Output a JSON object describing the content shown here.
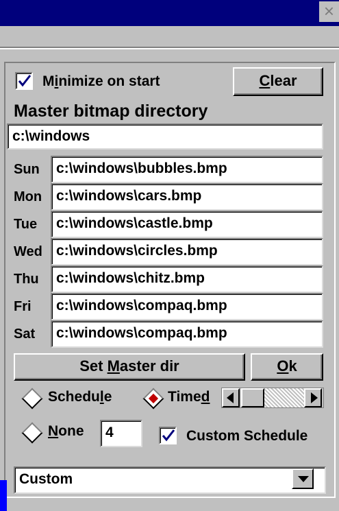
{
  "window": {
    "close_glyph": "×"
  },
  "minimize": {
    "label_pre": "M",
    "label_mnemonic": "i",
    "label_post": "nimize on start",
    "checked": true
  },
  "clear_button": {
    "mnemonic": "C",
    "rest": "lear"
  },
  "master": {
    "heading": "Master bitmap directory",
    "value": "c:\\windows"
  },
  "days": [
    {
      "label": "Sun",
      "path": "c:\\windows\\bubbles.bmp"
    },
    {
      "label": "Mon",
      "path": "c:\\windows\\cars.bmp"
    },
    {
      "label": "Tue",
      "path": "c:\\windows\\castle.bmp"
    },
    {
      "label": "Wed",
      "path": "c:\\windows\\circles.bmp"
    },
    {
      "label": "Thu",
      "path": "c:\\windows\\chitz.bmp"
    },
    {
      "label": "Fri",
      "path": "c:\\windows\\compaq.bmp"
    },
    {
      "label": "Sat",
      "path": "c:\\windows\\compaq.bmp"
    }
  ],
  "set_master_button": {
    "pre": "Set ",
    "mnemonic": "M",
    "post": "aster dir"
  },
  "ok_button": {
    "mnemonic": "O",
    "rest": "k"
  },
  "radios": {
    "schedule": {
      "pre": "Schedu",
      "mnemonic": "l",
      "post": "e",
      "selected": false
    },
    "timed": {
      "pre": "Time",
      "mnemonic": "d",
      "post": "",
      "selected": true
    },
    "none": {
      "pre": "",
      "mnemonic": "N",
      "post": "one",
      "selected": false
    }
  },
  "interval": {
    "value": "4"
  },
  "custom_schedule": {
    "label": "Custom Schedule",
    "checked": true
  },
  "dropdown": {
    "selected": "Custom"
  },
  "colors": {
    "titlebar": "#00007c",
    "face": "#c0c0c0",
    "check": "#00007c",
    "radio_dot": "#c00000"
  }
}
